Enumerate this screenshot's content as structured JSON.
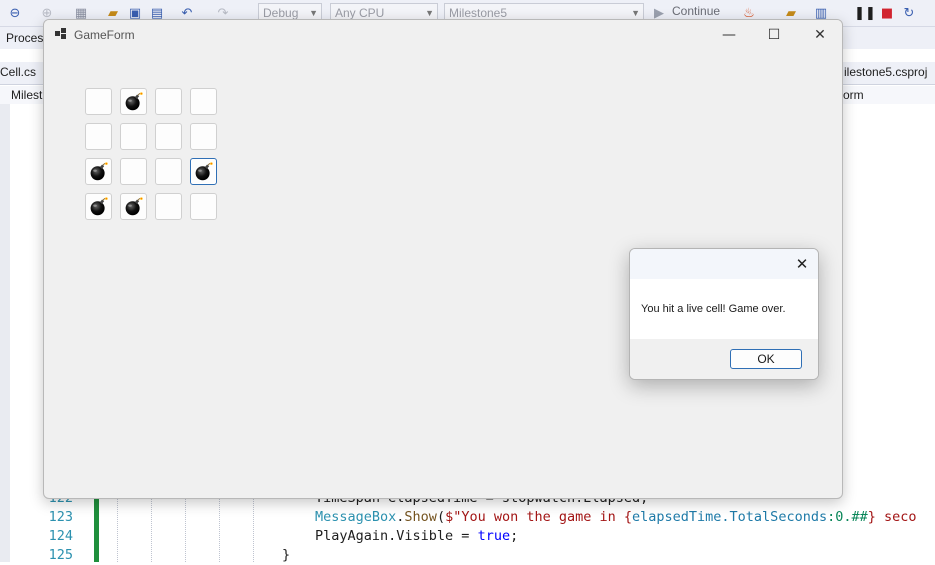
{
  "vs": {
    "toolbar": {
      "config": "Debug",
      "platform": "Any CPU",
      "project": "Milestone5",
      "continue": "Continue"
    },
    "menu": {
      "partial": "Proces"
    },
    "tabs": {
      "left": "Cell.cs",
      "right": "ilestone5.csproj"
    },
    "nav": {
      "left": "Milest",
      "right": "orm"
    },
    "code": {
      "lines": [
        {
          "num": "122",
          "text": "TimeSpan elapsedTime = stopwatch.Elapsed;"
        },
        {
          "num": "123",
          "call": "MessageBox",
          "method": "Show",
          "str1": "$\"You won the game in {",
          "fmtvar": "elapsedTime.TotalSeconds",
          "fmtspec": ":0.##",
          "str2": "} seco"
        },
        {
          "num": "124",
          "obj": "PlayAgain.Visible = ",
          "kw": "true",
          "end": ";"
        },
        {
          "num": "125",
          "text": "}"
        }
      ]
    }
  },
  "gameform": {
    "title": "GameForm",
    "controls": {
      "minimize": "—",
      "maximize": "☐",
      "close": "✕"
    },
    "grid": [
      [
        "empty",
        "bomb",
        "empty",
        "empty"
      ],
      [
        "empty",
        "empty",
        "empty",
        "empty"
      ],
      [
        "bomb",
        "empty",
        "empty",
        "bomb"
      ],
      [
        "bomb",
        "bomb",
        "empty",
        "empty"
      ]
    ]
  },
  "messagebox": {
    "close": "✕",
    "message": "You hit a live cell! Game over.",
    "ok": "OK"
  },
  "colors": {
    "accent": "#2f6fb5",
    "green_bar": "#1f8f3c"
  }
}
